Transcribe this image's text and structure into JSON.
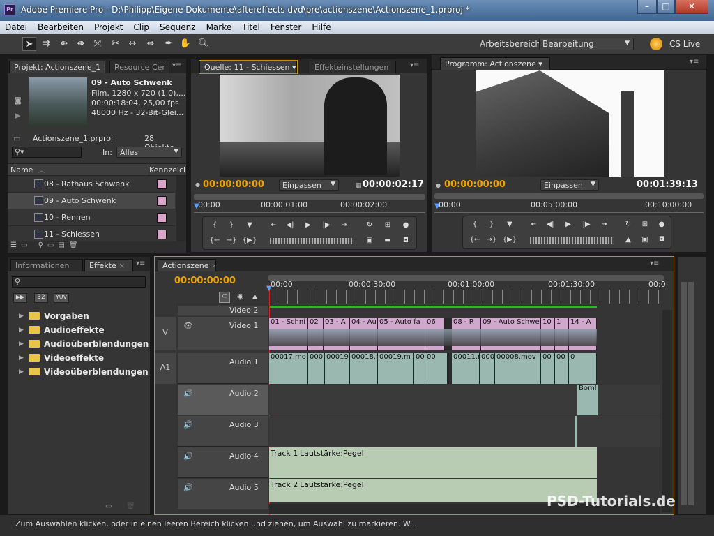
{
  "app": {
    "title": "Adobe Premiere Pro - D:\\Philipp\\Eigene Dokumente\\aftereffects dvd\\pre\\actionszene\\Actionszene_1.prproj *",
    "logo": "Pr"
  },
  "menu": [
    "Datei",
    "Bearbeiten",
    "Projekt",
    "Clip",
    "Sequenz",
    "Marke",
    "Titel",
    "Fenster",
    "Hilfe"
  ],
  "toolbar": {
    "workspace_label": "Arbeitsbereich:",
    "workspace_value": "Bearbeitung",
    "cs_live": "CS Live"
  },
  "project": {
    "tabs": [
      "Projekt: Actionszene_1",
      "Resource Cer"
    ],
    "clip_name": "09 - Auto Schwenk",
    "clip_info": [
      "Film, 1280 x 720 (1,0),...",
      "00:00:18:04, 25,00 fps",
      "48000 Hz - 32-Bit-Glei..."
    ],
    "file": "Actionszene_1.prproj",
    "count": "28 Objekte",
    "in_label": "In:",
    "in_value": "Alles",
    "col_name": "Name",
    "col_label": "Kennzeichn",
    "items": [
      "08 - Rathaus Schwenk",
      "09 - Auto Schwenk",
      "10 - Rennen",
      "11 - Schiessen"
    ]
  },
  "source": {
    "tabs": [
      "Quelle: 11 - Schiessen",
      "Effekteinstellungen"
    ],
    "tc_in": "00:00:00:00",
    "fit": "Einpassen",
    "tc_dur": "00:00:02:17",
    "ruler": [
      "00:00",
      "00:00:01:00",
      "00:00:02:00"
    ]
  },
  "program": {
    "tabs": [
      "Programm: Actionszene"
    ],
    "tc_in": "00:00:00:00",
    "fit": "Einpassen",
    "tc_dur": "00:01:39:13",
    "ruler": [
      "00:00",
      "00:05:00:00",
      "00:10:00:00"
    ]
  },
  "effects": {
    "tabs": [
      "Informationen",
      "Effekte"
    ],
    "badges": [
      "32",
      "YUV"
    ],
    "folders": [
      "Vorgaben",
      "Audioeffekte",
      "Audioüberblendungen",
      "Videoeffekte",
      "Videoüberblendungen"
    ]
  },
  "timeline": {
    "tab": "Actionszene",
    "tc": "00:00:00:00",
    "ruler": [
      "00:00",
      "00:00:30:00",
      "00:01:00:00",
      "00:01:30:00",
      "00:0"
    ],
    "video_tracks": [
      "Video 2",
      "Video 1"
    ],
    "audio_tracks": [
      "Audio 1",
      "Audio 2",
      "Audio 3",
      "Audio 4",
      "Audio 5"
    ],
    "v_label": "V",
    "a_label": "A1",
    "video_clips": [
      "01 - Schni",
      "02",
      "03 - A",
      "04 - Au",
      "05 - Auto fa",
      "06",
      "08 - R",
      "09 - Auto Schwe",
      "10",
      "1",
      "14 - A"
    ],
    "audio1_clips": [
      "00017.mo",
      "000",
      "00019",
      "00018.r",
      "00019.m",
      "00(",
      "00",
      "00011.r",
      "000",
      "00008.mov",
      "00",
      "00",
      "0"
    ],
    "audio2_clip": "Boml",
    "track1_label": "Track 1",
    "track2_label": "Track 2",
    "volume_label": "Lautstärke:Pegel"
  },
  "status": "Zum Auswählen klicken, oder in einen leeren Bereich klicken und ziehen, um Auswahl zu markieren. W...",
  "watermark": "PSD-Tutorials.de",
  "colors": {
    "timecode": "#f0a400",
    "video_clip": "#d0a8cc",
    "audio_clip": "#9ab8b0",
    "highlight": "#c89000"
  }
}
